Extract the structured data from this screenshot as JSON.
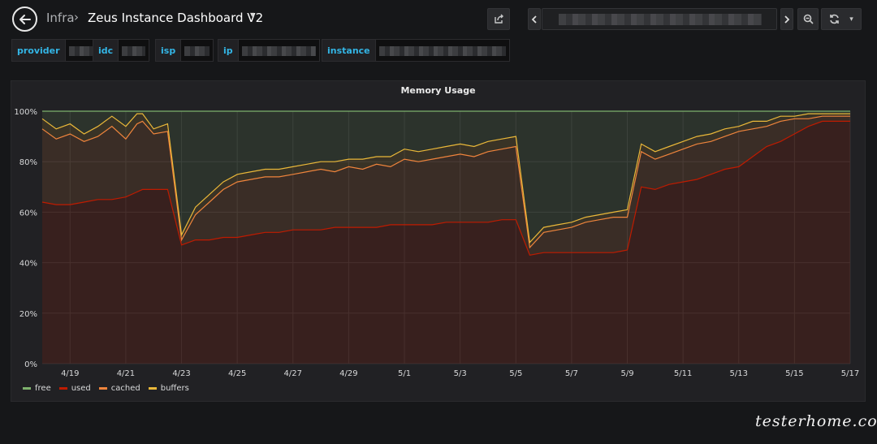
{
  "nav": {
    "folder": "Infra",
    "separator": "›",
    "title": "Zeus Instance Dashboard V2",
    "caret": "▾",
    "refresh_caret": "▾"
  },
  "variables": [
    {
      "label": "provider"
    },
    {
      "label": "idc"
    },
    {
      "label": "isp"
    },
    {
      "label": "ip"
    },
    {
      "label": "instance"
    }
  ],
  "panel": {
    "title": "Memory Usage"
  },
  "colors": {
    "free": "#7eb26d",
    "used": "#bf1b00",
    "cached": "#ef843c",
    "buffers": "#eab839",
    "bg": "#161719",
    "panel_bg": "#212124",
    "grid": "#343436",
    "var_label": "#33b5e5"
  },
  "icons": [
    "arrow-left-icon",
    "share-icon",
    "chevron-left-icon",
    "chevron-right-icon",
    "zoom-out-icon",
    "refresh-icon",
    "caret-down-icon"
  ],
  "chart_data": {
    "type": "area",
    "stacked": true,
    "title": "Memory Usage",
    "x_ticks": [
      "4/19",
      "4/21",
      "4/23",
      "4/25",
      "4/27",
      "4/29",
      "5/1",
      "5/3",
      "5/5",
      "5/7",
      "5/9",
      "5/11",
      "5/13",
      "5/15",
      "5/17"
    ],
    "x_range": [
      "4/18",
      "5/17"
    ],
    "y_ticks": [
      "0%",
      "20%",
      "40%",
      "60%",
      "80%",
      "100%"
    ],
    "ylim": [
      0,
      100
    ],
    "grid": true,
    "legend_position": "bottom-left",
    "series": [
      {
        "name": "free",
        "color": "#7eb26d"
      },
      {
        "name": "used",
        "color": "#bf1b00"
      },
      {
        "name": "cached",
        "color": "#ef843c"
      },
      {
        "name": "buffers",
        "color": "#eab839"
      }
    ],
    "x_days": [
      0,
      0.5,
      1,
      1.5,
      2,
      2.5,
      3,
      3.4,
      3.6,
      4,
      4.5,
      5,
      5.5,
      6,
      6.5,
      7,
      7.5,
      8,
      8.5,
      9,
      9.5,
      10,
      10.5,
      11,
      11.5,
      12,
      12.5,
      13,
      13.5,
      14,
      14.5,
      15,
      15.5,
      16,
      16.5,
      17,
      17.5,
      18,
      18.5,
      19,
      19.5,
      20,
      20.5,
      21,
      21.5,
      22,
      22.5,
      23,
      23.5,
      24,
      24.5,
      25,
      25.5,
      26,
      26.5,
      27,
      27.5,
      28,
      28.5,
      29
    ],
    "used": [
      64,
      63,
      63,
      64,
      65,
      65,
      66,
      68,
      69,
      69,
      69,
      47,
      49,
      49,
      50,
      50,
      51,
      52,
      52,
      53,
      53,
      53,
      54,
      54,
      54,
      54,
      55,
      55,
      55,
      55,
      56,
      56,
      56,
      56,
      57,
      57,
      43,
      44,
      44,
      44,
      44,
      44,
      44,
      45,
      70,
      69,
      71,
      72,
      73,
      75,
      77,
      78,
      82,
      86,
      88,
      91,
      94,
      96,
      96,
      96
    ],
    "cached": [
      93,
      89,
      91,
      88,
      90,
      94,
      89,
      95,
      96,
      91,
      92,
      49,
      59,
      64,
      69,
      72,
      73,
      74,
      74,
      75,
      76,
      77,
      76,
      78,
      77,
      79,
      78,
      81,
      80,
      81,
      82,
      83,
      82,
      84,
      85,
      86,
      46,
      52,
      53,
      54,
      56,
      57,
      58,
      58,
      84,
      81,
      83,
      85,
      87,
      88,
      90,
      92,
      93,
      94,
      96,
      97,
      97,
      98,
      98,
      98
    ],
    "buffers": [
      97,
      93,
      95,
      91,
      94,
      98,
      94,
      99,
      99,
      93,
      95,
      51,
      62,
      67,
      72,
      75,
      76,
      77,
      77,
      78,
      79,
      80,
      80,
      81,
      81,
      82,
      82,
      85,
      84,
      85,
      86,
      87,
      86,
      88,
      89,
      90,
      48,
      54,
      55,
      56,
      58,
      59,
      60,
      61,
      87,
      84,
      86,
      88,
      90,
      91,
      93,
      94,
      96,
      96,
      98,
      98,
      99,
      99,
      99,
      99
    ],
    "free": [
      100,
      100,
      100,
      100,
      100,
      100,
      100,
      100,
      100,
      100,
      100,
      100,
      100,
      100,
      100,
      100,
      100,
      100,
      100,
      100,
      100,
      100,
      100,
      100,
      100,
      100,
      100,
      100,
      100,
      100,
      100,
      100,
      100,
      100,
      100,
      100,
      100,
      100,
      100,
      100,
      100,
      100,
      100,
      100,
      100,
      100,
      100,
      100,
      100,
      100,
      100,
      100,
      100,
      100,
      100,
      100,
      100,
      100,
      100,
      100
    ]
  },
  "watermark": "testerhome.com"
}
